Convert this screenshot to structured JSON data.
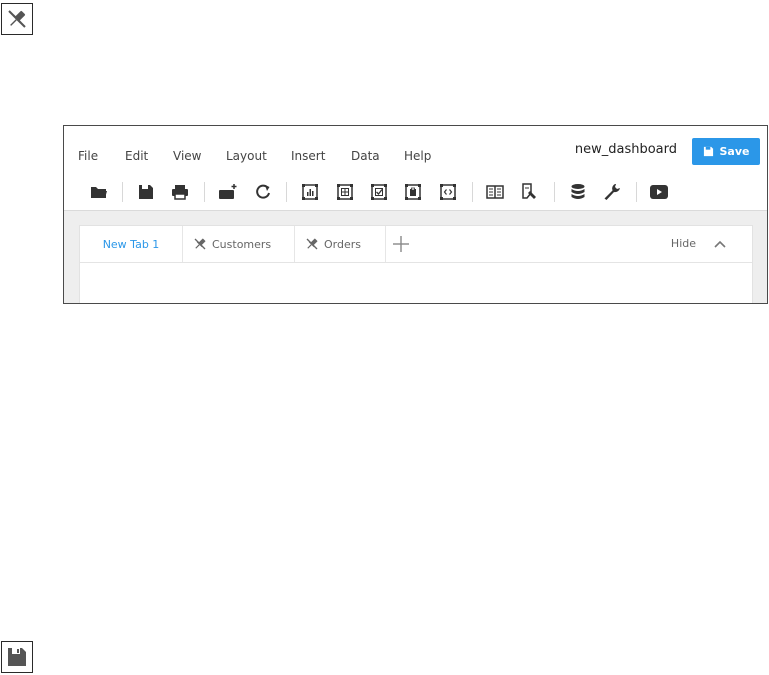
{
  "menu": {
    "items": [
      "File",
      "Edit",
      "View",
      "Layout",
      "Insert",
      "Data",
      "Help"
    ]
  },
  "header": {
    "dashboard_name": "new_dashboard",
    "save_label": "Save"
  },
  "toolbar": {
    "groups": [
      [
        "open-folder-icon"
      ],
      [
        "save-icon",
        "print-icon"
      ],
      [
        "add-widget-icon",
        "refresh-icon"
      ],
      [
        "chart-widget-icon",
        "table-widget-icon",
        "checkbox-widget-icon",
        "clipboard-widget-icon",
        "code-widget-icon"
      ],
      [
        "columns-icon",
        "edit-document-icon"
      ],
      [
        "database-icon",
        "wrench-icon"
      ],
      [
        "play-video-icon"
      ]
    ]
  },
  "tabs": [
    {
      "label": "New Tab 1",
      "active": true,
      "icon": null
    },
    {
      "label": "Customers",
      "active": false,
      "icon": "unpinned-icon"
    },
    {
      "label": "Orders",
      "active": false,
      "icon": "unpinned-icon"
    }
  ],
  "tabbar": {
    "hide_label": "Hide"
  },
  "colors": {
    "accent": "#2b97e8",
    "workspace_bg": "#eeeeee",
    "icon_dark": "#333333"
  }
}
